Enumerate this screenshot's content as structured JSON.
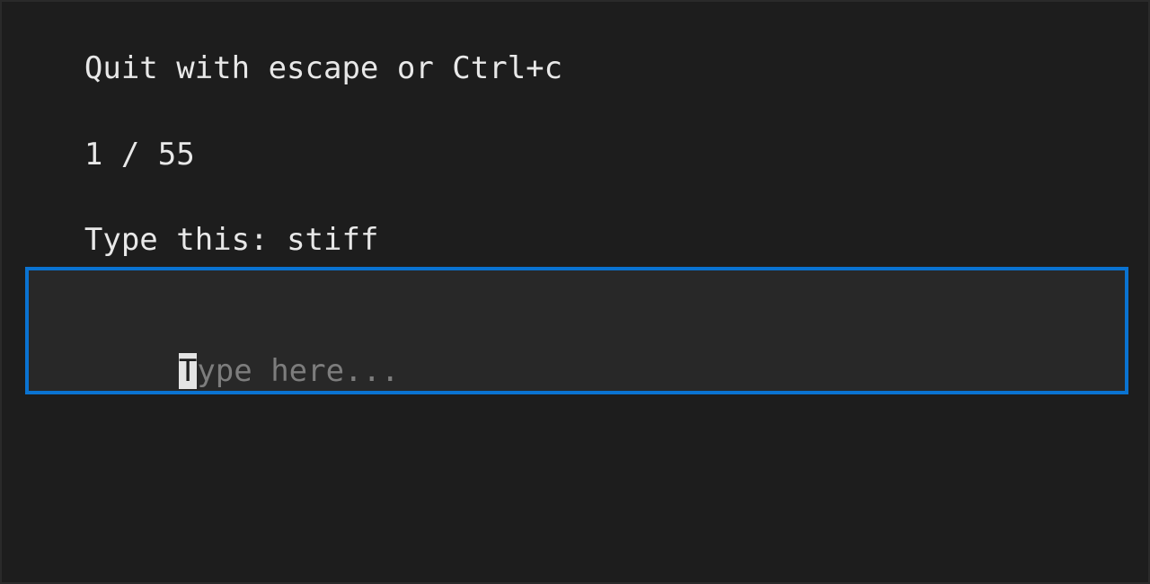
{
  "app": {
    "quit_hint": "Quit with escape or Ctrl+c",
    "progress": {
      "current": "1",
      "separator": " / ",
      "total": "55"
    },
    "prompt": {
      "label": "Type this: ",
      "word": "stiff"
    },
    "input": {
      "value": "",
      "placeholder_first": "T",
      "placeholder_rest": "ype here..."
    },
    "colors": {
      "background": "#1d1d1d",
      "text": "#e8e8e8",
      "input_border": "#0a73d1",
      "placeholder": "#7d7d7d"
    }
  }
}
